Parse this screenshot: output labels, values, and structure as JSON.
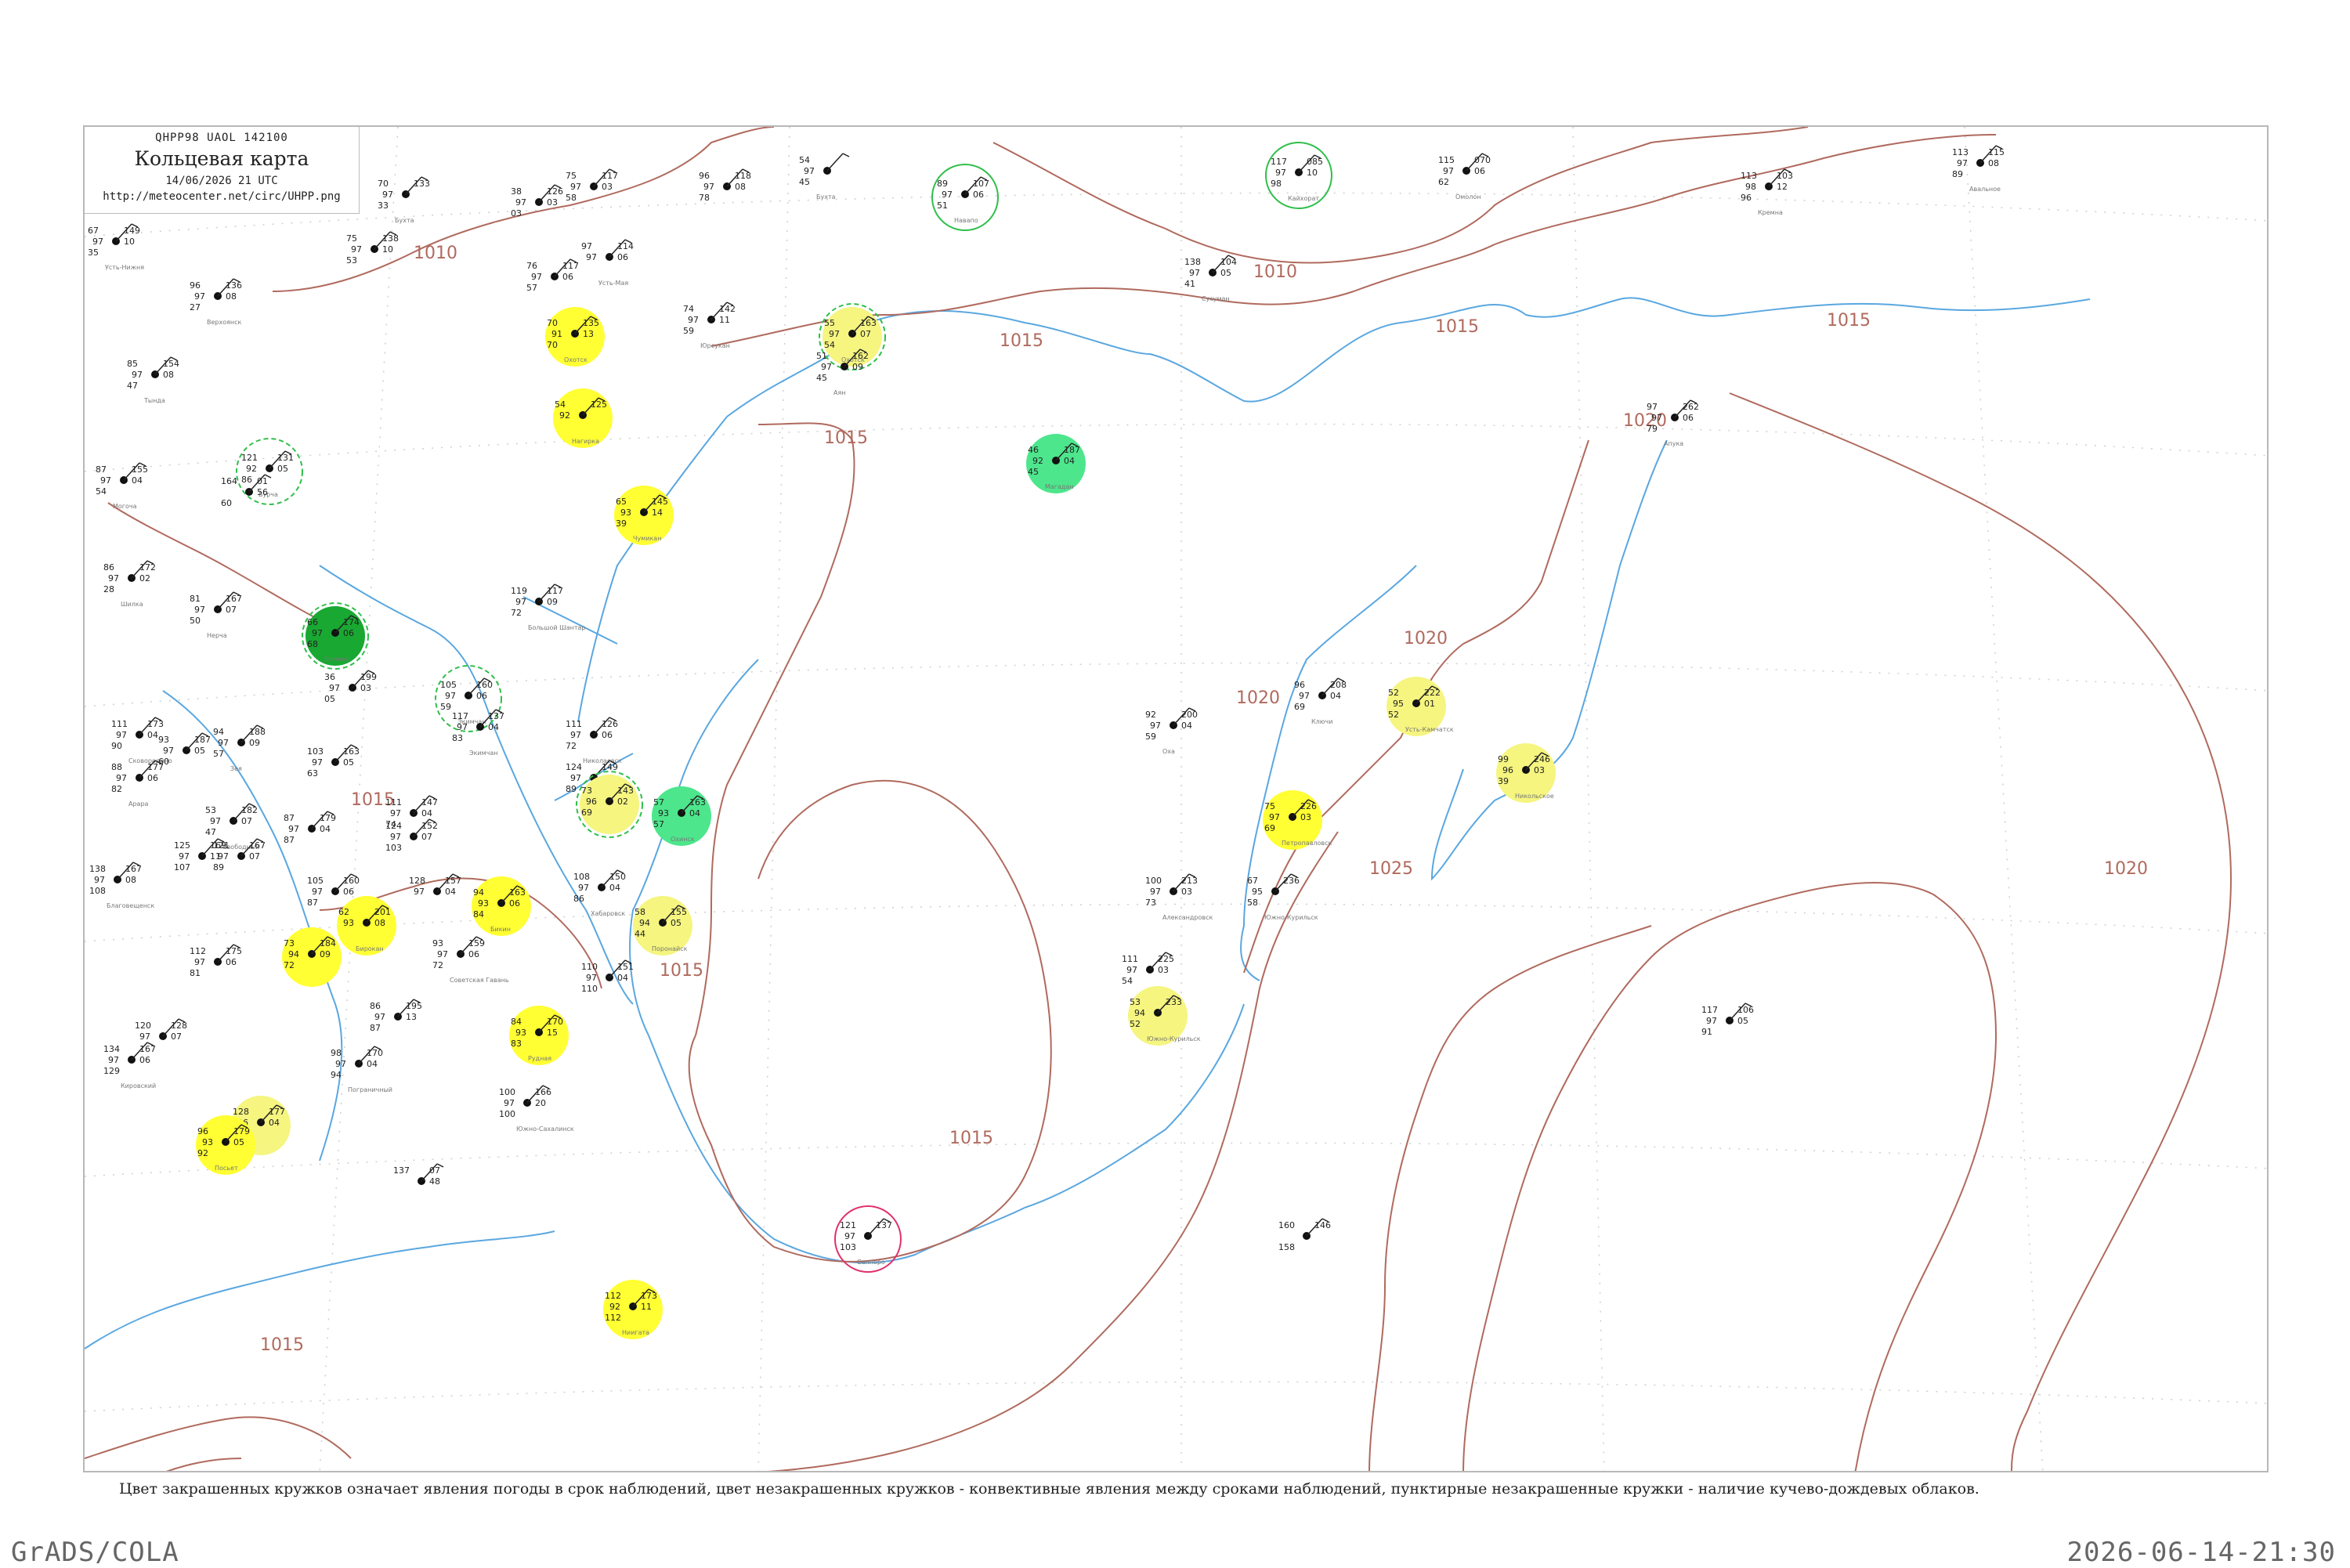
{
  "header": {
    "code": "QHPP98  UAOL  142100",
    "title": "Кольцевая карта",
    "time": "14/06/2026 21 UTC",
    "url": "http://meteocenter.net/circ/UHPP.png"
  },
  "note": "Цвет закрашенных кружков означает явления погоды в срок наблюдений, цвет незакрашенных кружков - конвективные явления между сроками наблюдений, пунктирные незакрашенные кружки - наличие кучево-дождевых облаков.",
  "footer": {
    "left": "GrADS/COLA",
    "right": "2026-06-14-21:30"
  },
  "colors": {
    "isobar": "#b06a5e",
    "water": "#5aa7e0",
    "grid": "#c8c8c8",
    "yellow": "#ffff33",
    "light_yellow": "#f5f580",
    "green": "#19a832",
    "light_green": "#4de68c",
    "ring_green": "#2fbf4a",
    "ring_red": "#e0306a"
  },
  "isobar_labels": [
    "1010",
    "1010",
    "1015",
    "1015",
    "1015",
    "1015",
    "1020",
    "1020",
    "1020",
    "1015",
    "1015",
    "1015",
    "1015",
    "1025",
    "1020"
  ],
  "stations": [
    {
      "t": "70",
      "p": "97",
      "v": "33",
      "d": "133",
      "name": "Бухта"
    },
    {
      "t": "75",
      "p": "97",
      "v": "58",
      "d": "117",
      "w": "03"
    },
    {
      "t": "96",
      "p": "97",
      "v": "78",
      "d": "118",
      "w": "08"
    },
    {
      "t": "54",
      "p": "97",
      "v": "45",
      "d": "",
      "w": "",
      "name": "Бухта"
    },
    {
      "t": "89",
      "p": "97",
      "v": "51",
      "d": "107",
      "w": "06",
      "name": "Навапо"
    },
    {
      "t": "117",
      "p": "97",
      "v": "98",
      "d": "085",
      "w": "10",
      "name": "Кайхорат"
    },
    {
      "t": "115",
      "p": "97",
      "v": "62",
      "d": "070",
      "w": "06",
      "name": "Омолон"
    },
    {
      "t": "113",
      "p": "98",
      "v": "96",
      "d": "103",
      "w": "12",
      "name": "Кремна"
    },
    {
      "t": "113",
      "p": "97",
      "v": "89",
      "d": "115",
      "w": "08",
      "name": "Авальное"
    },
    {
      "t": "67",
      "p": "97",
      "v": "35",
      "d": "149",
      "w": "10",
      "name": "Усть-Нижня"
    },
    {
      "t": "38",
      "p": "97",
      "v": "03",
      "d": "126",
      "w": "03"
    },
    {
      "t": "75",
      "p": "97",
      "v": "53",
      "d": "138",
      "w": "10"
    },
    {
      "t": "96",
      "p": "97",
      "v": "27",
      "d": "136",
      "w": "08",
      "name": "Верхоянск"
    },
    {
      "t": "76",
      "p": "97",
      "v": "57",
      "d": "117",
      "w": "06"
    },
    {
      "t": "97",
      "p": "97",
      "v": "",
      "d": "114",
      "w": "06",
      "name": "Усть-Мая"
    },
    {
      "t": "138",
      "p": "97",
      "v": "41",
      "d": "104",
      "w": "05",
      "name": "Сусуман"
    },
    {
      "t": "74",
      "p": "97",
      "v": "59",
      "d": "142",
      "w": "11",
      "name": "Юрсукан"
    },
    {
      "t": "70",
      "p": "91",
      "v": "70",
      "d": "135",
      "w": "13",
      "name": "Охотск"
    },
    {
      "t": "55",
      "p": "97",
      "v": "54",
      "d": "163",
      "w": "07",
      "name": "Охотск"
    },
    {
      "t": "51",
      "p": "97",
      "v": "45",
      "d": "162",
      "w": "09",
      "name": "Аян"
    },
    {
      "t": "85",
      "p": "97",
      "v": "47",
      "d": "154",
      "w": "08",
      "name": "Тында"
    },
    {
      "t": "54",
      "p": "92",
      "v": "",
      "d": "125",
      "w": "",
      "name": "Нагирка"
    },
    {
      "t": "121",
      "p": "92",
      "v": "86",
      "d": "131",
      "w": "05",
      "name": "Бурча"
    },
    {
      "t": "87",
      "p": "97",
      "v": "54",
      "d": "155",
      "w": "04",
      "name": "Могоча"
    },
    {
      "t": "164",
      "p": "",
      "v": "60",
      "d": "01",
      "w": "56"
    },
    {
      "t": "65",
      "p": "93",
      "v": "39",
      "d": "145",
      "w": "14",
      "name": "Чумикан"
    },
    {
      "t": "46",
      "p": "92",
      "v": "45",
      "d": "187",
      "w": "04",
      "name": "Магадан"
    },
    {
      "t": "86",
      "p": "97",
      "v": "28",
      "d": "172",
      "w": "02",
      "name": "Шилка"
    },
    {
      "t": "81",
      "p": "97",
      "v": "50",
      "d": "167",
      "w": "07",
      "name": "Нерча"
    },
    {
      "t": "119",
      "p": "97",
      "v": "72",
      "d": "117",
      "w": "09",
      "name": "Большой Шантар"
    },
    {
      "t": "66",
      "p": "97",
      "v": "68",
      "d": "174",
      "w": "06",
      "name": "Бомнак"
    },
    {
      "t": "36",
      "p": "97",
      "v": "05",
      "d": "199",
      "w": "03"
    },
    {
      "t": "105",
      "p": "97",
      "v": "59",
      "d": "160",
      "w": "06",
      "name": "Экимчан"
    },
    {
      "t": "117",
      "p": "97",
      "v": "83",
      "d": "137",
      "w": "04",
      "name": "Экимчан"
    },
    {
      "t": "111",
      "p": "97",
      "v": "72",
      "d": "126",
      "w": "06",
      "name": "Николаевск"
    },
    {
      "t": "92",
      "p": "97",
      "v": "59",
      "d": "200",
      "w": "04",
      "name": "Оха"
    },
    {
      "t": "96",
      "p": "97",
      "v": "69",
      "d": "208",
      "w": "04",
      "name": "Ключи"
    },
    {
      "t": "52",
      "p": "95",
      "v": "52",
      "d": "222",
      "w": "01",
      "name": "Усть-Камчатск"
    },
    {
      "t": "99",
      "p": "96",
      "v": "39",
      "d": "246",
      "w": "03",
      "name": "Никольское"
    },
    {
      "t": "97",
      "p": "97",
      "v": "79",
      "d": "262",
      "w": "06",
      "name": "Апука"
    },
    {
      "t": "111",
      "p": "97",
      "v": "90",
      "d": "173",
      "w": "04",
      "name": "Сковородино"
    },
    {
      "t": "93",
      "p": "97",
      "v": "60",
      "d": "187",
      "w": "05"
    },
    {
      "t": "94",
      "p": "97",
      "v": "57",
      "d": "188",
      "w": "09",
      "name": "Зея"
    },
    {
      "t": "88",
      "p": "97",
      "v": "82",
      "d": "177",
      "w": "06",
      "name": "Арара"
    },
    {
      "t": "103",
      "p": "97",
      "v": "63",
      "d": "163",
      "w": "05"
    },
    {
      "t": "124",
      "p": "97",
      "v": "89",
      "d": "149",
      "w": ""
    },
    {
      "t": "73",
      "p": "96",
      "v": "69",
      "d": "143",
      "w": "02"
    },
    {
      "t": "57",
      "p": "93",
      "v": "57",
      "d": "163",
      "w": "04",
      "name": "Охинск"
    },
    {
      "t": "111",
      "p": "97",
      "v": "74",
      "d": "147",
      "w": "04"
    },
    {
      "t": "53",
      "p": "97",
      "v": "47",
      "d": "182",
      "w": "07",
      "name": "Свободный"
    },
    {
      "t": "87",
      "p": "97",
      "v": "87",
      "d": "179",
      "w": "04"
    },
    {
      "t": "124",
      "p": "97",
      "v": "103",
      "d": "152",
      "w": "07"
    },
    {
      "t": "75",
      "p": "97",
      "v": "69",
      "d": "226",
      "w": "03",
      "name": "Петропавловск"
    },
    {
      "t": "125",
      "p": "97",
      "v": "107",
      "d": "169",
      "w": "11"
    },
    {
      "t": "121",
      "p": "97",
      "v": "89",
      "d": "167",
      "w": "07"
    },
    {
      "t": "138",
      "p": "97",
      "v": "108",
      "d": "167",
      "w": "08",
      "name": "Благовещенск"
    },
    {
      "t": "105",
      "p": "97",
      "v": "87",
      "d": "160",
      "w": "06"
    },
    {
      "t": "128",
      "p": "97",
      "v": "",
      "d": "157",
      "w": "04"
    },
    {
      "t": "108",
      "p": "97",
      "v": "86",
      "d": "150",
      "w": "04",
      "name": "Хабаровск"
    },
    {
      "t": "100",
      "p": "97",
      "v": "73",
      "d": "213",
      "w": "03",
      "name": "Александровск"
    },
    {
      "t": "67",
      "p": "95",
      "v": "58",
      "d": "236",
      "w": "",
      "name": "Южно-Курильск"
    },
    {
      "t": "94",
      "p": "93",
      "v": "84",
      "d": "163",
      "w": "06",
      "name": "Бикин"
    },
    {
      "t": "62",
      "p": "93",
      "v": "",
      "d": "201",
      "w": "08",
      "name": "Бирокан"
    },
    {
      "t": "58",
      "p": "94",
      "v": "44",
      "d": "155",
      "w": "05",
      "name": "Поронайск"
    },
    {
      "t": "73",
      "p": "94",
      "v": "72",
      "d": "184",
      "w": "09"
    },
    {
      "t": "112",
      "p": "97",
      "v": "81",
      "d": "175",
      "w": "06"
    },
    {
      "t": "93",
      "p": "97",
      "v": "72",
      "d": "159",
      "w": "06",
      "name": "Советская Гавань"
    },
    {
      "t": "110",
      "p": "97",
      "v": "110",
      "d": "151",
      "w": "04"
    },
    {
      "t": "111",
      "p": "97",
      "v": "54",
      "d": "225",
      "w": "03"
    },
    {
      "t": "53",
      "p": "94",
      "v": "52",
      "d": "233",
      "w": "",
      "name": "Южно-Курильск"
    },
    {
      "t": "120",
      "p": "97",
      "v": "",
      "d": "128",
      "w": "07"
    },
    {
      "t": "86",
      "p": "97",
      "v": "87",
      "d": "195",
      "w": "13"
    },
    {
      "t": "84",
      "p": "93",
      "v": "83",
      "d": "170",
      "w": "15",
      "name": "Рудная"
    },
    {
      "t": "134",
      "p": "97",
      "v": "129",
      "d": "167",
      "w": "06",
      "name": "Кировский"
    },
    {
      "t": "98",
      "p": "97",
      "v": "94",
      "d": "170",
      "w": "04",
      "name": "Пограничный"
    },
    {
      "t": "100",
      "p": "97",
      "v": "100",
      "d": "166",
      "w": "20",
      "name": "Южно-Сахалинск"
    },
    {
      "t": "117",
      "p": "97",
      "v": "91",
      "d": "106",
      "w": "05"
    },
    {
      "t": "128",
      "p": "96",
      "v": "115",
      "d": "177",
      "w": "04"
    },
    {
      "t": "96",
      "p": "93",
      "v": "92",
      "d": "179",
      "w": "05",
      "name": "Посьет"
    },
    {
      "t": "137",
      "p": "",
      "v": "",
      "d": "07",
      "w": "48"
    },
    {
      "t": "121",
      "p": "97",
      "v": "103",
      "d": "137",
      "w": "",
      "name": "Саппоро"
    },
    {
      "t": "160",
      "p": "",
      "v": "158",
      "d": "146",
      "w": ""
    },
    {
      "t": "112",
      "p": "92",
      "v": "112",
      "d": "173",
      "w": "11",
      "name": "Ниигата"
    }
  ]
}
